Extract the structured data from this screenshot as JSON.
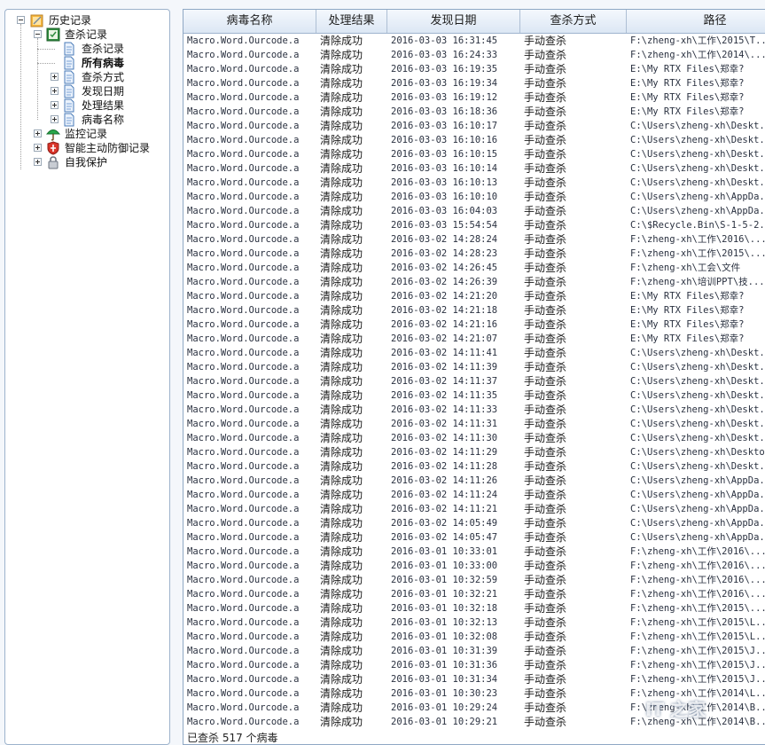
{
  "tree": {
    "root": "历史记录",
    "scan": "查杀记录",
    "scan_children": [
      "查杀记录",
      "所有病毒",
      "查杀方式",
      "发现日期",
      "处理结果",
      "病毒名称"
    ],
    "monitor": "监控记录",
    "defense": "智能主动防御记录",
    "selfprotect": "自我保护"
  },
  "columns": [
    "病毒名称",
    "处理结果",
    "发现日期",
    "查杀方式",
    "路径"
  ],
  "rows": [
    [
      "Macro.Word.Ourcode.a",
      "清除成功",
      "2016-03-03 16:31:45",
      "手动查杀",
      "F:\\zheng-xh\\工作\\2015\\T..."
    ],
    [
      "Macro.Word.Ourcode.a",
      "清除成功",
      "2016-03-03 16:24:33",
      "手动查杀",
      "F:\\zheng-xh\\工作\\2014\\..."
    ],
    [
      "Macro.Word.Ourcode.a",
      "清除成功",
      "2016-03-03 16:19:35",
      "手动查杀",
      "E:\\My RTX Files\\郑幸?"
    ],
    [
      "Macro.Word.Ourcode.a",
      "清除成功",
      "2016-03-03 16:19:34",
      "手动查杀",
      "E:\\My RTX Files\\郑幸?"
    ],
    [
      "Macro.Word.Ourcode.a",
      "清除成功",
      "2016-03-03 16:19:12",
      "手动查杀",
      "E:\\My RTX Files\\郑幸?"
    ],
    [
      "Macro.Word.Ourcode.a",
      "清除成功",
      "2016-03-03 16:18:36",
      "手动查杀",
      "E:\\My RTX Files\\郑幸?"
    ],
    [
      "Macro.Word.Ourcode.a",
      "清除成功",
      "2016-03-03 16:10:17",
      "手动查杀",
      "C:\\Users\\zheng-xh\\Deskt..."
    ],
    [
      "Macro.Word.Ourcode.a",
      "清除成功",
      "2016-03-03 16:10:16",
      "手动查杀",
      "C:\\Users\\zheng-xh\\Deskt..."
    ],
    [
      "Macro.Word.Ourcode.a",
      "清除成功",
      "2016-03-03 16:10:15",
      "手动查杀",
      "C:\\Users\\zheng-xh\\Deskt..."
    ],
    [
      "Macro.Word.Ourcode.a",
      "清除成功",
      "2016-03-03 16:10:14",
      "手动查杀",
      "C:\\Users\\zheng-xh\\Deskt..."
    ],
    [
      "Macro.Word.Ourcode.a",
      "清除成功",
      "2016-03-03 16:10:13",
      "手动查杀",
      "C:\\Users\\zheng-xh\\Deskt..."
    ],
    [
      "Macro.Word.Ourcode.a",
      "清除成功",
      "2016-03-03 16:10:10",
      "手动查杀",
      "C:\\Users\\zheng-xh\\AppDa..."
    ],
    [
      "Macro.Word.Ourcode.a",
      "清除成功",
      "2016-03-03 16:04:03",
      "手动查杀",
      "C:\\Users\\zheng-xh\\AppDa..."
    ],
    [
      "Macro.Word.Ourcode.a",
      "清除成功",
      "2016-03-03 15:54:54",
      "手动查杀",
      "C:\\$Recycle.Bin\\S-1-5-2..."
    ],
    [
      "Macro.Word.Ourcode.a",
      "清除成功",
      "2016-03-02 14:28:24",
      "手动查杀",
      "F:\\zheng-xh\\工作\\2016\\..."
    ],
    [
      "Macro.Word.Ourcode.a",
      "清除成功",
      "2016-03-02 14:28:23",
      "手动查杀",
      "F:\\zheng-xh\\工作\\2015\\..."
    ],
    [
      "Macro.Word.Ourcode.a",
      "清除成功",
      "2016-03-02 14:26:45",
      "手动查杀",
      "F:\\zheng-xh\\工会\\文件"
    ],
    [
      "Macro.Word.Ourcode.a",
      "清除成功",
      "2016-03-02 14:26:39",
      "手动查杀",
      "F:\\zheng-xh\\培训PPT\\技..."
    ],
    [
      "Macro.Word.Ourcode.a",
      "清除成功",
      "2016-03-02 14:21:20",
      "手动查杀",
      "E:\\My RTX Files\\郑幸?"
    ],
    [
      "Macro.Word.Ourcode.a",
      "清除成功",
      "2016-03-02 14:21:18",
      "手动查杀",
      "E:\\My RTX Files\\郑幸?"
    ],
    [
      "Macro.Word.Ourcode.a",
      "清除成功",
      "2016-03-02 14:21:16",
      "手动查杀",
      "E:\\My RTX Files\\郑幸?"
    ],
    [
      "Macro.Word.Ourcode.a",
      "清除成功",
      "2016-03-02 14:21:07",
      "手动查杀",
      "E:\\My RTX Files\\郑幸?"
    ],
    [
      "Macro.Word.Ourcode.a",
      "清除成功",
      "2016-03-02 14:11:41",
      "手动查杀",
      "C:\\Users\\zheng-xh\\Deskt..."
    ],
    [
      "Macro.Word.Ourcode.a",
      "清除成功",
      "2016-03-02 14:11:39",
      "手动查杀",
      "C:\\Users\\zheng-xh\\Deskt..."
    ],
    [
      "Macro.Word.Ourcode.a",
      "清除成功",
      "2016-03-02 14:11:37",
      "手动查杀",
      "C:\\Users\\zheng-xh\\Deskt..."
    ],
    [
      "Macro.Word.Ourcode.a",
      "清除成功",
      "2016-03-02 14:11:35",
      "手动查杀",
      "C:\\Users\\zheng-xh\\Deskt..."
    ],
    [
      "Macro.Word.Ourcode.a",
      "清除成功",
      "2016-03-02 14:11:33",
      "手动查杀",
      "C:\\Users\\zheng-xh\\Deskt..."
    ],
    [
      "Macro.Word.Ourcode.a",
      "清除成功",
      "2016-03-02 14:11:31",
      "手动查杀",
      "C:\\Users\\zheng-xh\\Deskt..."
    ],
    [
      "Macro.Word.Ourcode.a",
      "清除成功",
      "2016-03-02 14:11:30",
      "手动查杀",
      "C:\\Users\\zheng-xh\\Deskt..."
    ],
    [
      "Macro.Word.Ourcode.a",
      "清除成功",
      "2016-03-02 14:11:29",
      "手动查杀",
      "C:\\Users\\zheng-xh\\Desktop"
    ],
    [
      "Macro.Word.Ourcode.a",
      "清除成功",
      "2016-03-02 14:11:28",
      "手动查杀",
      "C:\\Users\\zheng-xh\\Deskt..."
    ],
    [
      "Macro.Word.Ourcode.a",
      "清除成功",
      "2016-03-02 14:11:26",
      "手动查杀",
      "C:\\Users\\zheng-xh\\AppDa..."
    ],
    [
      "Macro.Word.Ourcode.a",
      "清除成功",
      "2016-03-02 14:11:24",
      "手动查杀",
      "C:\\Users\\zheng-xh\\AppDa..."
    ],
    [
      "Macro.Word.Ourcode.a",
      "清除成功",
      "2016-03-02 14:11:21",
      "手动查杀",
      "C:\\Users\\zheng-xh\\AppDa..."
    ],
    [
      "Macro.Word.Ourcode.a",
      "清除成功",
      "2016-03-02 14:05:49",
      "手动查杀",
      "C:\\Users\\zheng-xh\\AppDa..."
    ],
    [
      "Macro.Word.Ourcode.a",
      "清除成功",
      "2016-03-02 14:05:47",
      "手动查杀",
      "C:\\Users\\zheng-xh\\AppDa..."
    ],
    [
      "Macro.Word.Ourcode.a",
      "清除成功",
      "2016-03-01 10:33:01",
      "手动查杀",
      "F:\\zheng-xh\\工作\\2016\\..."
    ],
    [
      "Macro.Word.Ourcode.a",
      "清除成功",
      "2016-03-01 10:33:00",
      "手动查杀",
      "F:\\zheng-xh\\工作\\2016\\..."
    ],
    [
      "Macro.Word.Ourcode.a",
      "清除成功",
      "2016-03-01 10:32:59",
      "手动查杀",
      "F:\\zheng-xh\\工作\\2016\\..."
    ],
    [
      "Macro.Word.Ourcode.a",
      "清除成功",
      "2016-03-01 10:32:21",
      "手动查杀",
      "F:\\zheng-xh\\工作\\2016\\..."
    ],
    [
      "Macro.Word.Ourcode.a",
      "清除成功",
      "2016-03-01 10:32:18",
      "手动查杀",
      "F:\\zheng-xh\\工作\\2015\\..."
    ],
    [
      "Macro.Word.Ourcode.a",
      "清除成功",
      "2016-03-01 10:32:13",
      "手动查杀",
      "F:\\zheng-xh\\工作\\2015\\L..."
    ],
    [
      "Macro.Word.Ourcode.a",
      "清除成功",
      "2016-03-01 10:32:08",
      "手动查杀",
      "F:\\zheng-xh\\工作\\2015\\L..."
    ],
    [
      "Macro.Word.Ourcode.a",
      "清除成功",
      "2016-03-01 10:31:39",
      "手动查杀",
      "F:\\zheng-xh\\工作\\2015\\J..."
    ],
    [
      "Macro.Word.Ourcode.a",
      "清除成功",
      "2016-03-01 10:31:36",
      "手动查杀",
      "F:\\zheng-xh\\工作\\2015\\J..."
    ],
    [
      "Macro.Word.Ourcode.a",
      "清除成功",
      "2016-03-01 10:31:34",
      "手动查杀",
      "F:\\zheng-xh\\工作\\2015\\J..."
    ],
    [
      "Macro.Word.Ourcode.a",
      "清除成功",
      "2016-03-01 10:30:23",
      "手动查杀",
      "F:\\zheng-xh\\工作\\2014\\L..."
    ],
    [
      "Macro.Word.Ourcode.a",
      "清除成功",
      "2016-03-01 10:29:24",
      "手动查杀",
      "F:\\zheng-xh\\工作\\2014\\B..."
    ],
    [
      "Macro.Word.Ourcode.a",
      "清除成功",
      "2016-03-01 10:29:21",
      "手动查杀",
      "F:\\zheng-xh\\工作\\2014\\B..."
    ]
  ],
  "status": "已查杀 517 个病毒",
  "watermark": "IT 之家"
}
